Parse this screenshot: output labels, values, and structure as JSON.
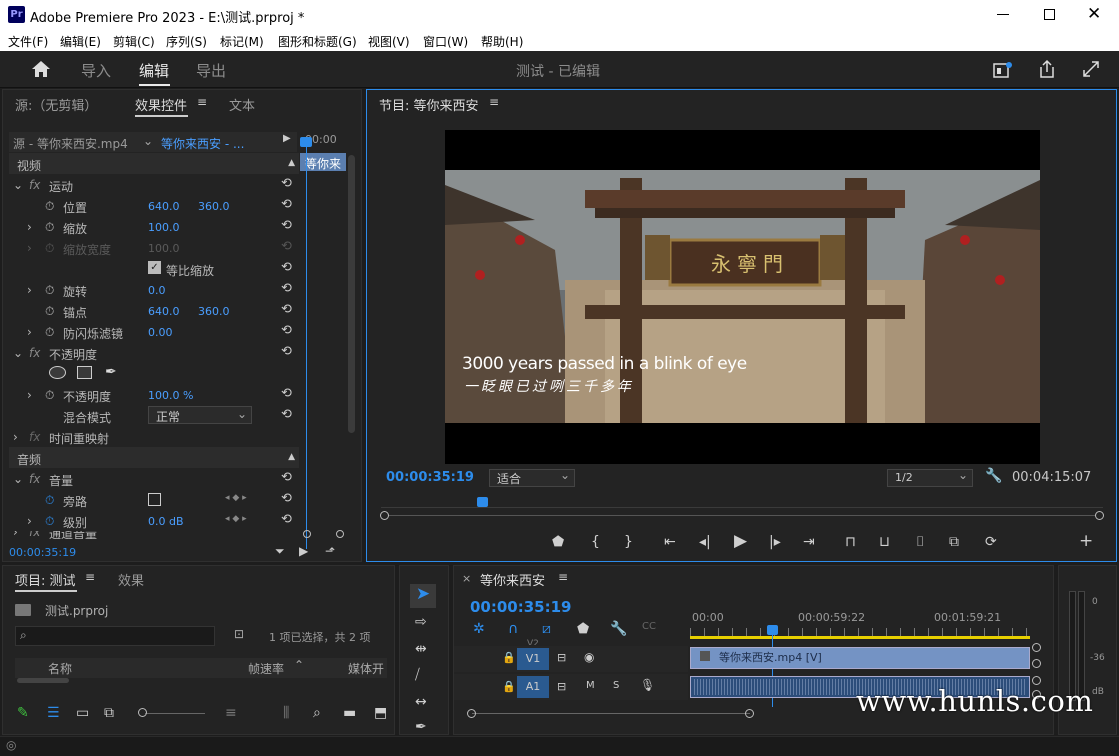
{
  "window": {
    "app_badge": "Pr",
    "title": "Adobe Premiere Pro 2023 - E:\\测试.prproj *"
  },
  "menu": [
    "文件(F)",
    "编辑(E)",
    "剪辑(C)",
    "序列(S)",
    "标记(M)",
    "图形和标题(G)",
    "视图(V)",
    "窗口(W)",
    "帮助(H)"
  ],
  "workspace": {
    "tabs": [
      "导入",
      "编辑",
      "导出"
    ],
    "active": "编辑",
    "project_status": "测试 - 已编辑"
  },
  "source_panel": {
    "tabs": [
      "源:（无剪辑）",
      "效果控件",
      "文本"
    ],
    "source_clip": "源 - 等你来西安.mp4",
    "seq_clip": "等你来西安 - ...",
    "ruler_time": "00:00",
    "clip_label": "等你来",
    "section_video": "视频",
    "motion": {
      "name": "运动",
      "position_label": "位置",
      "position_x": "640.0",
      "position_y": "360.0",
      "scale_label": "缩放",
      "scale": "100.0",
      "scale_width_label": "缩放宽度",
      "scale_width": "100.0",
      "uniform_label": "等比缩放",
      "rotation_label": "旋转",
      "rotation": "0.0",
      "anchor_label": "锚点",
      "anchor_x": "640.0",
      "anchor_y": "360.0",
      "flicker_label": "防闪烁滤镜",
      "flicker": "0.00"
    },
    "opacity": {
      "name": "不透明度",
      "opacity_label": "不透明度",
      "opacity": "100.0 %",
      "blend_label": "混合模式",
      "blend": "正常"
    },
    "time_remap": "时间重映射",
    "section_audio": "音频",
    "volume": {
      "name": "音量",
      "bypass_label": "旁路",
      "level_label": "级别",
      "level": "0.0 dB",
      "channel_label": "通道音量"
    },
    "timecode": "00:00:35:19"
  },
  "program": {
    "title": "节目: 等你来西安",
    "subtitle_en": "3000 years passed in a blink of eye",
    "subtitle_cn": "一眨眼已过咧三千多年",
    "gate_plaque": "永寧門",
    "timecode": "00:00:35:19",
    "fit": "适合",
    "resolution": "1/2",
    "duration": "00:04:15:07",
    "playhead_fraction": 0.14
  },
  "project": {
    "tabs": [
      "项目: 测试",
      "效果"
    ],
    "file": "测试.prproj",
    "selection": "1 项已选择，共 2 项",
    "col_name": "名称",
    "col_fps": "帧速率",
    "col_media": "媒体开"
  },
  "timeline": {
    "seq_name": "等你来西安",
    "timecode": "00:00:35:19",
    "ruler": [
      "00:00",
      "00:00:59:22",
      "00:01:59:21"
    ],
    "v_track": "V1",
    "a_track": "A1",
    "v_clip": "等你来西安.mp4 [V]",
    "track_m": "M",
    "track_s": "S",
    "track_v_hidden": "V2",
    "playhead_fraction": 0.24
  },
  "meter": {
    "ticks": [
      "0",
      "-36",
      "dB"
    ]
  },
  "watermark": "www.hunls.com"
}
